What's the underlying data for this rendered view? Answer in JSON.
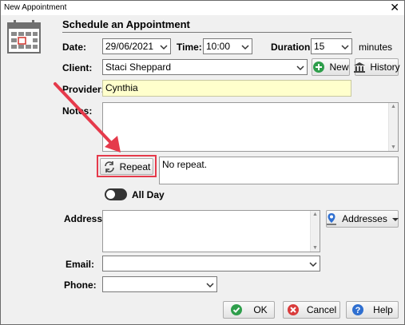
{
  "window": {
    "title": "New Appointment",
    "close_glyph": "✕"
  },
  "heading": "Schedule an Appointment",
  "fields": {
    "date_label": "Date:",
    "date_value": "29/06/2021",
    "time_label": "Time:",
    "time_value": "10:00",
    "duration_label": "Duration:",
    "duration_value": "15",
    "duration_unit": "minutes",
    "client_label": "Client:",
    "client_value": "Staci Sheppard",
    "provider_label": "Provider:",
    "provider_value": "Cynthia",
    "notes_label": "Notes:",
    "repeat_summary": "No repeat.",
    "allday_label": "All Day",
    "address_label": "Address:",
    "email_label": "Email:",
    "phone_label": "Phone:"
  },
  "buttons": {
    "new": "New",
    "history": "History",
    "repeat": "Repeat",
    "addresses": "Addresses",
    "ok": "OK",
    "cancel": "Cancel",
    "help": "Help"
  },
  "colors": {
    "provider_bg": "#ffffcc",
    "annotation_red": "#e53a4b",
    "ok_green": "#2e9e4b",
    "cancel_red": "#d93b3b",
    "help_blue": "#2f6fd0"
  },
  "icons": {
    "calendar": "calendar-icon",
    "new": "plus-circle-icon",
    "history": "bank-icon",
    "repeat": "refresh-icon",
    "addresses": "map-pin-icon",
    "ok": "check-circle-icon",
    "cancel": "x-circle-icon",
    "help": "question-circle-icon"
  },
  "state": {
    "all_day": false
  }
}
